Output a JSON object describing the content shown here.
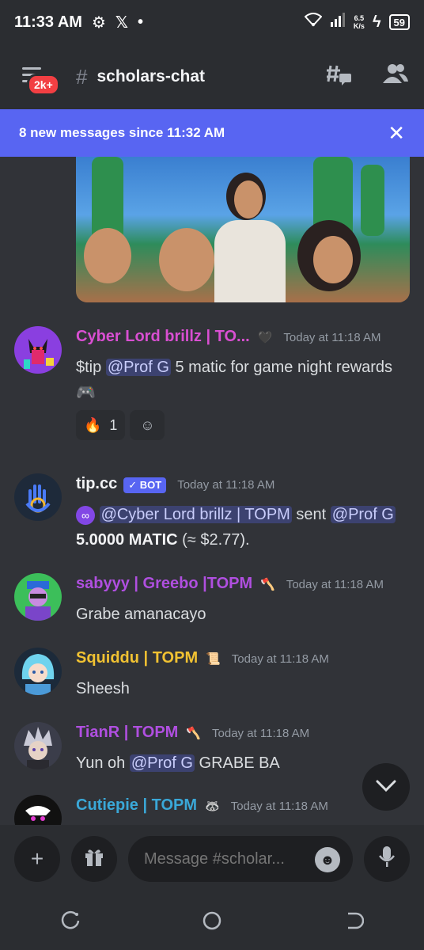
{
  "status_bar": {
    "time": "11:33 AM",
    "speed_value": "6.5",
    "speed_unit": "K/s",
    "battery": "59"
  },
  "header": {
    "badge": "2k+",
    "channel_name": "scholars-chat"
  },
  "new_messages_bar": {
    "text": "8 new messages since 11:32 AM"
  },
  "messages": [
    {
      "author": "Cyber Lord brillz | TO...",
      "author_color": "#d94fd2",
      "timestamp": "Today at 11:18 AM",
      "content": {
        "prefix": "$tip ",
        "mention": "@Prof G",
        "suffix": " 5 matic for game night rewards 🎮"
      },
      "reactions": [
        {
          "emoji": "🔥",
          "count": "1"
        }
      ]
    },
    {
      "author": "tip.cc",
      "author_color": "#f2f3f5",
      "bot_badge": "✓ BOT",
      "timestamp": "Today at 11:18 AM",
      "content": {
        "mention1": "@Cyber Lord brillz | TOPM",
        "mid1": " sent ",
        "mention2": "@Prof G",
        "amount": " 5.0000 MATIC",
        "suffix": " (≈ $2.77)."
      }
    },
    {
      "author": "sabyyy | Greebo |TOPM",
      "author_color": "#b04fe0",
      "timestamp": "Today at 11:18 AM",
      "content": "Grabe amanacayo"
    },
    {
      "author": "Squiddu | TOPM",
      "author_color": "#f1c232",
      "timestamp": "Today at 11:18 AM",
      "content": "Sheesh"
    },
    {
      "author": "TianR | TOPM",
      "author_color": "#b04fe0",
      "timestamp": "Today at 11:18 AM",
      "content": {
        "prefix": "Yun oh ",
        "mention": "@Prof G",
        "suffix": " GRABE BA"
      }
    },
    {
      "author": "Cutiepie | TOPM",
      "author_color": "#3aa8d8",
      "timestamp": "Today at 11:18 AM"
    }
  ],
  "composer": {
    "placeholder": "Message #scholar..."
  }
}
